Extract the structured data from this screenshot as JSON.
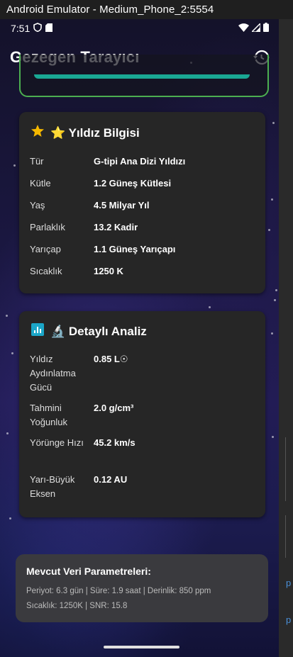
{
  "window": {
    "title": "Android Emulator - Medium_Phone_2:5554"
  },
  "statusbar": {
    "time": "7:51"
  },
  "appbar": {
    "title": "Gezegen Tarayıcı",
    "history_icon": "history-icon"
  },
  "star_card": {
    "title": "⭐ Yıldız Bilgisi",
    "icon": "star-icon",
    "rows": [
      {
        "label": "Tür",
        "value": "G-tipi Ana Dizi Yıldızı"
      },
      {
        "label": "Kütle",
        "value": "1.2 Güneş Kütlesi"
      },
      {
        "label": "Yaş",
        "value": "4.5 Milyar Yıl"
      },
      {
        "label": "Parlaklık",
        "value": "13.2 Kadir"
      },
      {
        "label": "Yarıçap",
        "value": "1.1 Güneş Yarıçapı"
      },
      {
        "label": "Sıcaklık",
        "value": "1250 K"
      }
    ]
  },
  "analysis_card": {
    "title": "🔬 Detaylı Analiz",
    "icon": "analytics-icon",
    "rows": [
      {
        "label": "Yıldız Aydınlatma Gücü",
        "value": "0.85 L☉"
      },
      {
        "label": "Tahmini Yoğunluk",
        "value": "2.0 g/cm³"
      },
      {
        "label": "Yörünge Hızı",
        "value": "45.2 km/s"
      },
      {
        "label": "Yarı-Büyük Eksen",
        "value": "0.12 AU"
      }
    ]
  },
  "params_card": {
    "title": "Mevcut Veri Parametreleri:",
    "line1": "Periyot: 6.3 gün | Süre: 1.9 saat | Derinlik: 850 ppm",
    "line2": "Sıcaklık: 1250K | SNR: 15.8"
  },
  "colors": {
    "accent_green": "#4caf50",
    "teal_button": "#1aa894",
    "star_yellow": "#f5b800",
    "analytics_teal": "#1ba6c8",
    "card_bg": "#262626"
  },
  "right_strip": {
    "marks": [
      "p",
      "p"
    ]
  }
}
